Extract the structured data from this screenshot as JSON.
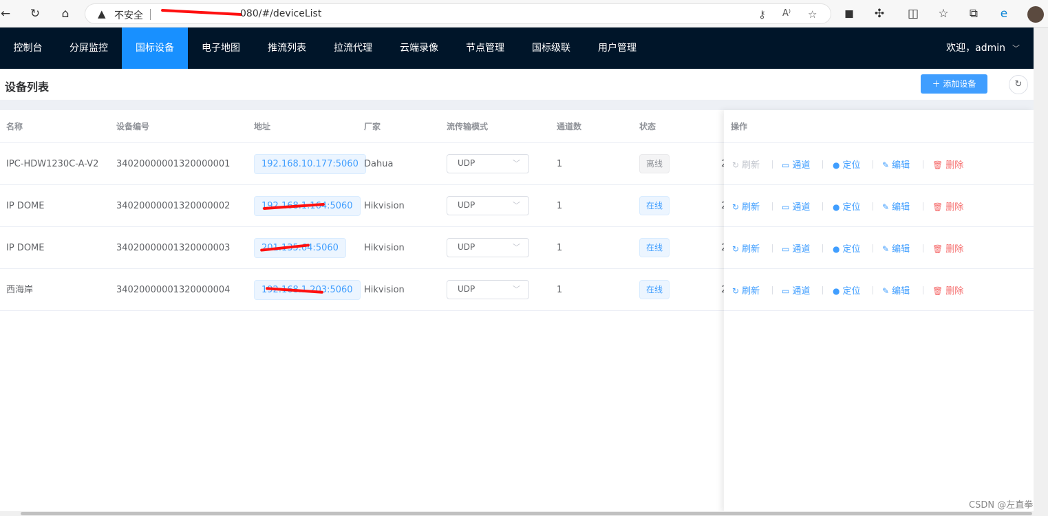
{
  "browser": {
    "back_icon": "back-arrow-icon",
    "reload_icon": "reload-icon",
    "home_icon": "home-icon",
    "insecure_label": "不安全",
    "url": "080/#/deviceList"
  },
  "nav": {
    "items": [
      {
        "label": "控制台",
        "active": false
      },
      {
        "label": "分屏监控",
        "active": false
      },
      {
        "label": "国标设备",
        "active": true
      },
      {
        "label": "电子地图",
        "active": false
      },
      {
        "label": "推流列表",
        "active": false
      },
      {
        "label": "拉流代理",
        "active": false
      },
      {
        "label": "云端录像",
        "active": false
      },
      {
        "label": "节点管理",
        "active": false
      },
      {
        "label": "国标级联",
        "active": false
      },
      {
        "label": "用户管理",
        "active": false
      }
    ],
    "user_greeting": "欢迎，admin"
  },
  "page": {
    "title": "设备列表",
    "add_button": "添加设备"
  },
  "table": {
    "headers": {
      "name": "名称",
      "device_id": "设备编号",
      "address": "地址",
      "manufacturer": "厂家",
      "transport": "流传输模式",
      "channels": "通道数",
      "status": "状态",
      "actions": "操作"
    },
    "rows": [
      {
        "name": "IPC-HDW1230C-A-V2",
        "device_id": "34020000001320000001",
        "address": "192.168.10.177:5060",
        "manufacturer": "Dahua",
        "transport": "UDP",
        "channels": "1",
        "status": "离线",
        "online": false,
        "trunc": "2"
      },
      {
        "name": "IP DOME",
        "device_id": "34020000001320000002",
        "address": "192.168.1.164:5060",
        "manufacturer": "Hikvision",
        "transport": "UDP",
        "channels": "1",
        "status": "在线",
        "online": true,
        "trunc": "2"
      },
      {
        "name": "IP DOME",
        "device_id": "34020000001320000003",
        "address": "201.135.64:5060",
        "manufacturer": "Hikvision",
        "transport": "UDP",
        "channels": "1",
        "status": "在线",
        "online": true,
        "trunc": "2"
      },
      {
        "name": "西海岸",
        "device_id": "34020000001320000004",
        "address": "192.168.1.203:5060",
        "manufacturer": "Hikvision",
        "transport": "UDP",
        "channels": "1",
        "status": "在线",
        "online": true,
        "trunc": "2"
      }
    ],
    "actions": {
      "refresh": "刷新",
      "channel": "通道",
      "locate": "定位",
      "edit": "编辑",
      "delete": "删除"
    }
  },
  "watermark": "CSDN @左直拳"
}
